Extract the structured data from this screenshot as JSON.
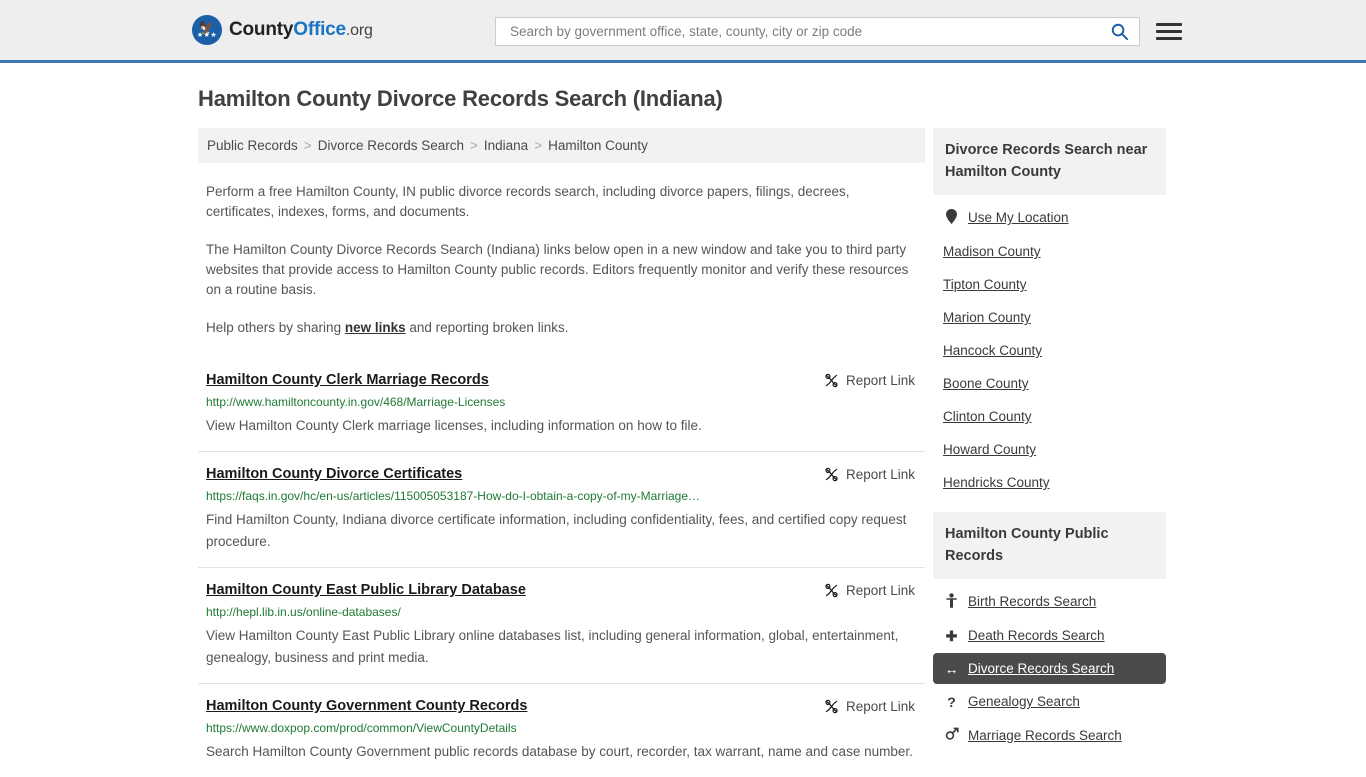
{
  "header": {
    "logo": {
      "part1": "County",
      "part2": "Office",
      "part3": ".org",
      "icon": "eagle-seal-icon"
    },
    "search": {
      "placeholder": "Search by government office, state, county, city or zip code",
      "value": "",
      "search_icon": "search-icon"
    },
    "menu_icon": "hamburger-menu-icon"
  },
  "page": {
    "title": "Hamilton County Divorce Records Search (Indiana)"
  },
  "breadcrumb": {
    "separator": ">",
    "items": [
      {
        "label": "Public Records"
      },
      {
        "label": "Divorce Records Search"
      },
      {
        "label": "Indiana"
      },
      {
        "label": "Hamilton County"
      }
    ]
  },
  "intro": {
    "p1": "Perform a free Hamilton County, IN public divorce records search, including divorce papers, filings, decrees, certificates, indexes, forms, and documents.",
    "p2": "The Hamilton County Divorce Records Search (Indiana) links below open in a new window and take you to third party websites that provide access to Hamilton County public records. Editors frequently monitor and verify these resources on a routine basis.",
    "p3_before": "Help others by sharing ",
    "p3_link": "new links",
    "p3_after": " and reporting broken links."
  },
  "results": {
    "report_label": "Report Link",
    "report_icon": "broken-link-icon",
    "items": [
      {
        "title": "Hamilton County Clerk Marriage Records",
        "url": "http://www.hamiltoncounty.in.gov/468/Marriage-Licenses",
        "description": "View Hamilton County Clerk marriage licenses, including information on how to file."
      },
      {
        "title": "Hamilton County Divorce Certificates",
        "url": "https://faqs.in.gov/hc/en-us/articles/115005053187-How-do-I-obtain-a-copy-of-my-Marriage…",
        "description": "Find Hamilton County, Indiana divorce certificate information, including confidentiality, fees, and certified copy request procedure."
      },
      {
        "title": "Hamilton County East Public Library Database",
        "url": "http://hepl.lib.in.us/online-databases/",
        "description": "View Hamilton County East Public Library online databases list, including general information, global, entertainment, genealogy, business and print media."
      },
      {
        "title": "Hamilton County Government County Records",
        "url": "https://www.doxpop.com/prod/common/ViewCountyDetails",
        "description": "Search Hamilton County Government public records database by court, recorder, tax warrant, name and case number."
      }
    ]
  },
  "sidebar": {
    "panels": [
      {
        "heading": "Divorce Records Search near Hamilton County",
        "items": [
          {
            "label": "Use My Location",
            "icon": "map-pin-icon",
            "active": false
          },
          {
            "label": "Madison County",
            "icon": "",
            "active": false
          },
          {
            "label": "Tipton County",
            "icon": "",
            "active": false
          },
          {
            "label": "Marion County",
            "icon": "",
            "active": false
          },
          {
            "label": "Hancock County",
            "icon": "",
            "active": false
          },
          {
            "label": "Boone County",
            "icon": "",
            "active": false
          },
          {
            "label": "Clinton County",
            "icon": "",
            "active": false
          },
          {
            "label": "Howard County",
            "icon": "",
            "active": false
          },
          {
            "label": "Hendricks County",
            "icon": "",
            "active": false
          }
        ]
      },
      {
        "heading": "Hamilton County Public Records",
        "items": [
          {
            "label": "Birth Records Search",
            "icon": "baby-icon",
            "active": false
          },
          {
            "label": "Death Records Search",
            "icon": "cross-icon",
            "active": false
          },
          {
            "label": "Divorce Records Search",
            "icon": "split-arrows-icon",
            "active": true
          },
          {
            "label": "Genealogy Search",
            "icon": "question-mark-icon",
            "active": false
          },
          {
            "label": "Marriage Records Search",
            "icon": "gender-symbols-icon",
            "active": false
          }
        ]
      }
    ]
  },
  "colors": {
    "brand_blue": "#1a5fa8",
    "header_border": "#3d7ab0",
    "url_green": "#1f7a33",
    "active_bg": "#4a4a4a",
    "panel_head_bg": "#f2f2f2"
  }
}
